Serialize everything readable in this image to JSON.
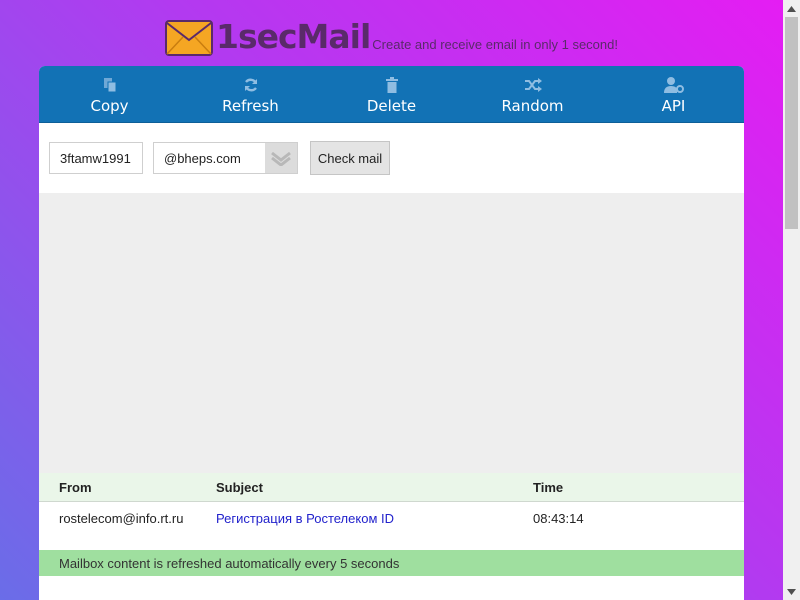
{
  "header": {
    "logo_text": "1secMail",
    "tagline": "Create and receive email in only 1 second!"
  },
  "toolbar": {
    "copy": "Copy",
    "refresh": "Refresh",
    "delete": "Delete",
    "random": "Random",
    "api": "API"
  },
  "controls": {
    "username": "3ftamw1991",
    "domain": "@bheps.com",
    "check_label": "Check mail"
  },
  "inbox": {
    "columns": {
      "from": "From",
      "subject": "Subject",
      "time": "Time"
    },
    "rows": [
      {
        "from": "rostelecom@info.rt.ru",
        "subject": "Регистрация в Ростелеком ID",
        "time": "08:43:14"
      }
    ]
  },
  "notice": "Mailbox content is refreshed automatically every 5 seconds",
  "colors": {
    "toolbar": "#1272b5",
    "notice": "#9fdf9f",
    "link": "#2222cc"
  }
}
